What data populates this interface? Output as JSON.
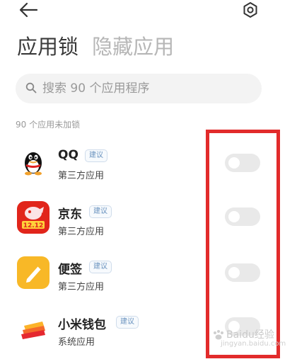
{
  "header": {
    "back_icon": "arrow-left-icon",
    "settings_icon": "gear-icon"
  },
  "tabs": [
    {
      "label": "应用锁",
      "active": true
    },
    {
      "label": "隐藏应用",
      "active": false
    }
  ],
  "search": {
    "placeholder": "搜索 90 个应用程序",
    "icon": "search-icon"
  },
  "section": {
    "label": "90 个应用未加锁"
  },
  "apps": [
    {
      "name": "QQ",
      "badge": "建议",
      "category": "第三方应用",
      "icon": "qq-penguin-icon",
      "locked": false
    },
    {
      "name": "京东",
      "badge": "建议",
      "category": "第三方应用",
      "icon": "jd-icon",
      "locked": false
    },
    {
      "name": "便签",
      "badge": "建议",
      "category": "第三方应用",
      "icon": "notes-icon",
      "locked": false
    },
    {
      "name": "小米钱包",
      "badge": "建议",
      "category": "系统应用",
      "icon": "mi-wallet-icon",
      "locked": false
    }
  ],
  "watermark": {
    "text": "Baidu经验",
    "sub": "jingyan.baidu.com"
  },
  "colors": {
    "highlight": "#e22b2b",
    "badge_text": "#6a93bf",
    "toggle_off": "#e9e9e9"
  }
}
